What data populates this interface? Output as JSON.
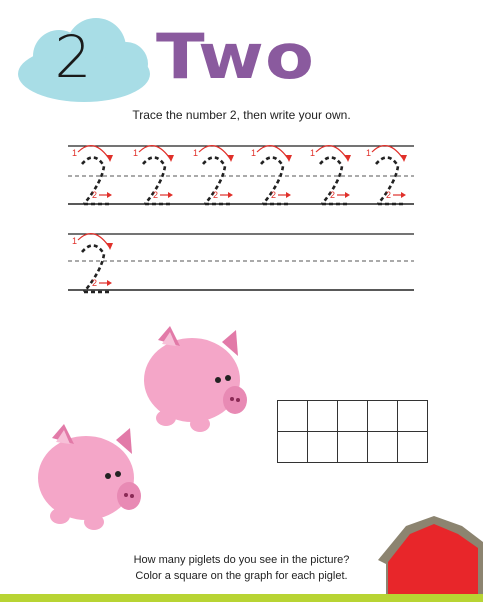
{
  "header": {
    "numeral": "2",
    "word": "Two"
  },
  "instruction": "Trace the number 2, then write your own.",
  "tracing": {
    "arc_label": "1",
    "stroke_label": "2"
  },
  "question": {
    "line1": "How many piglets do you see in the picture?",
    "line2": "Color a square on the graph for each piglet."
  },
  "graph": {
    "rows": 2,
    "cols": 5
  },
  "colors": {
    "cloud": "#a8dde6",
    "title": "#8a5a9e",
    "pig": "#f4a6c8",
    "pig_dark": "#e27aa8",
    "barn_red": "#e8262a",
    "barn_roof": "#8c8470",
    "bar": "#b8d433",
    "guide_red": "#e0302a"
  },
  "icons": [
    "cloud-icon",
    "pig-icon",
    "barn-icon",
    "arrow-icon"
  ]
}
